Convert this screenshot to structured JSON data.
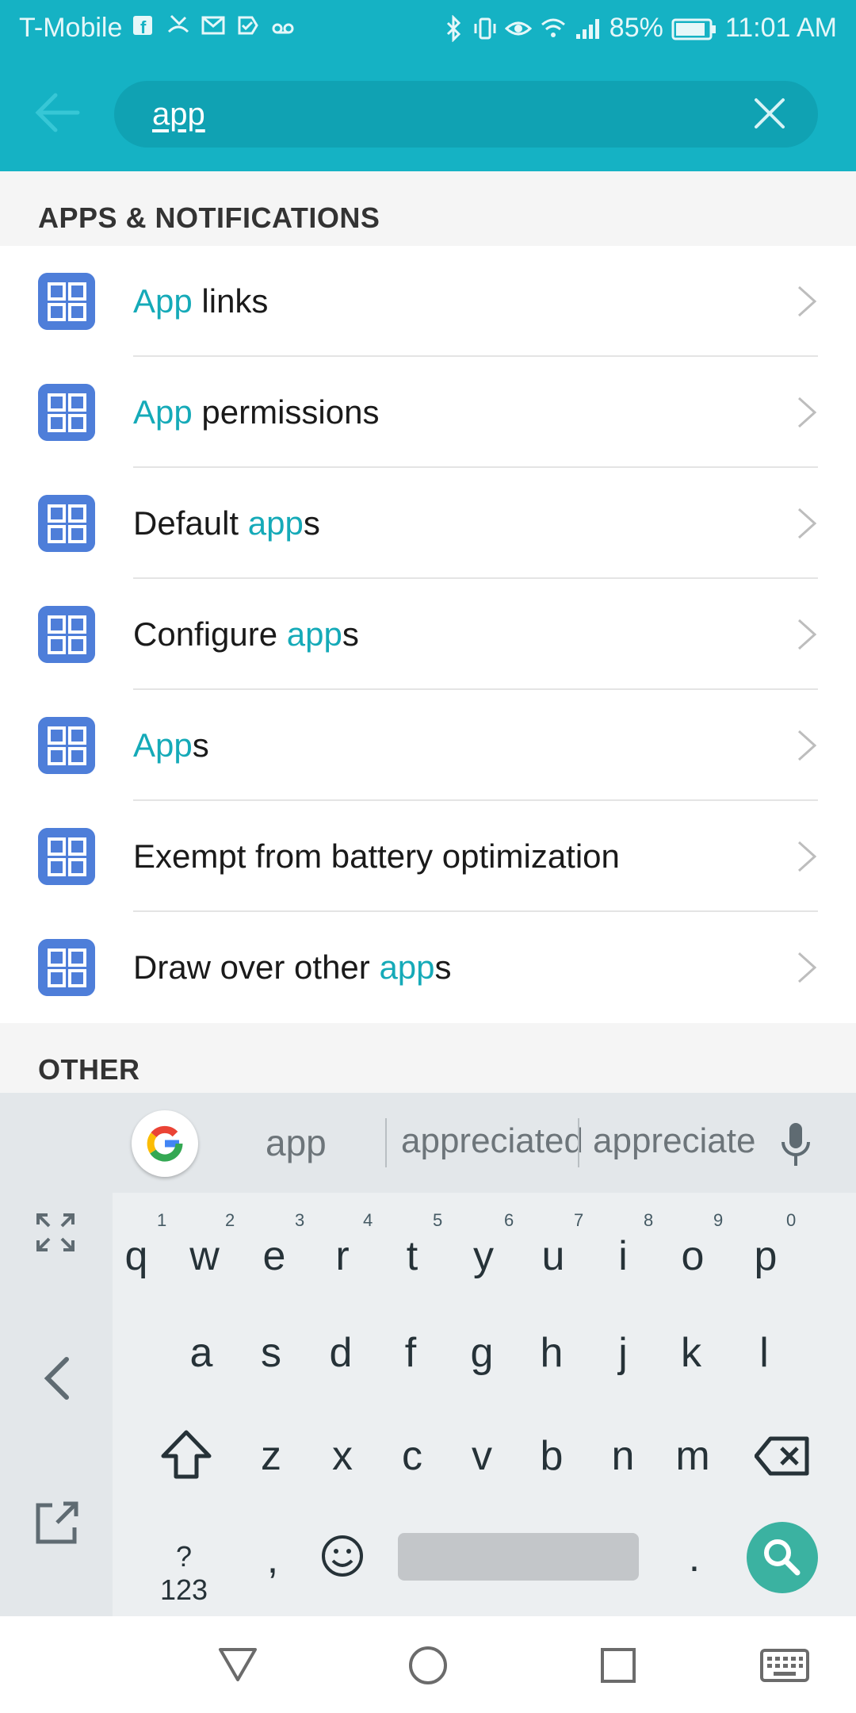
{
  "status_bar": {
    "carrier": "T-Mobile",
    "battery": "85%",
    "time": "11:01 AM",
    "notification_icons": [
      "facebook-icon",
      "missed-call-icon",
      "gmail-icon",
      "check-icon",
      "voicemail-icon"
    ],
    "system_icons": [
      "bluetooth-icon",
      "vibrate-icon",
      "eye-comfort-icon",
      "wifi-icon",
      "signal-icon",
      "battery-icon"
    ]
  },
  "search": {
    "query": "app"
  },
  "sections": {
    "apps_notifications": "APPS & NOTIFICATIONS",
    "other": "OTHER"
  },
  "results": [
    {
      "pre": "",
      "hl": "App",
      "post": " links"
    },
    {
      "pre": "",
      "hl": "App",
      "post": " permissions"
    },
    {
      "pre": "Default ",
      "hl": "app",
      "post": "s"
    },
    {
      "pre": "Configure ",
      "hl": "app",
      "post": "s"
    },
    {
      "pre": "",
      "hl": "App",
      "post": "s"
    },
    {
      "pre": "Exempt from battery optimization",
      "hl": "",
      "post": ""
    },
    {
      "pre": "Draw over other ",
      "hl": "app",
      "post": "s"
    }
  ],
  "keyboard": {
    "suggestions": [
      "app",
      "appreciated",
      "appreciate"
    ],
    "row1": [
      "q",
      "w",
      "e",
      "r",
      "t",
      "y",
      "u",
      "i",
      "o",
      "p"
    ],
    "row1_nums": [
      "1",
      "2",
      "3",
      "4",
      "5",
      "6",
      "7",
      "8",
      "9",
      "0"
    ],
    "row2": [
      "a",
      "s",
      "d",
      "f",
      "g",
      "h",
      "j",
      "k",
      "l"
    ],
    "row3": [
      "z",
      "x",
      "c",
      "v",
      "b",
      "n",
      "m"
    ],
    "sym_key": "?123",
    "comma": ",",
    "period": "."
  },
  "colors": {
    "accent": "#15b2c4",
    "highlight": "#15aab8",
    "app_icon": "#4e7ed9",
    "search_key": "#3bb2a1"
  }
}
